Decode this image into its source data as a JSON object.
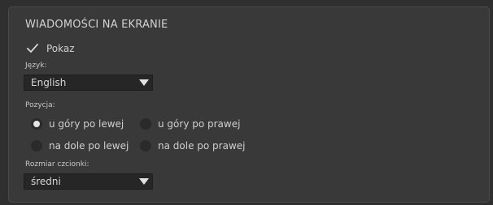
{
  "section": {
    "title": "WIADOMOŚCI NA EKRANIE"
  },
  "show_checkbox": {
    "label": "Pokaz",
    "checked": true
  },
  "language": {
    "label": "Język:",
    "selected": "English"
  },
  "position": {
    "label": "Pozycja:",
    "options": [
      {
        "label": "u góry po lewej",
        "checked": true
      },
      {
        "label": "u góry po prawej",
        "checked": false
      },
      {
        "label": "na dole po lewej",
        "checked": false
      },
      {
        "label": "na dole po prawej",
        "checked": false
      }
    ]
  },
  "font_size": {
    "label": "Rozmiar czcionki:",
    "selected": "średni"
  },
  "icons": {
    "checkbox": "checkmark-icon",
    "dropdown": "chevron-down-icon"
  }
}
